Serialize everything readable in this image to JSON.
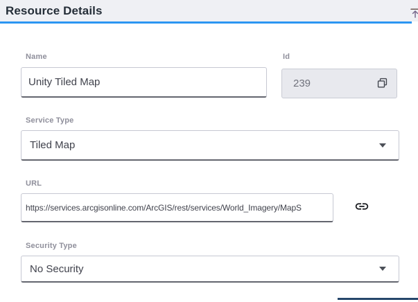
{
  "header": {
    "title": "Resource Details",
    "accent_color": "#2b96f2",
    "collapse_icon": "scroll-to-top-icon"
  },
  "form": {
    "name": {
      "label": "Name",
      "value": "Unity Tiled Map"
    },
    "id": {
      "label": "Id",
      "value": "239",
      "copy_icon": "copy-icon"
    },
    "service_type": {
      "label": "Service Type",
      "value": "Tiled Map",
      "caret_icon": "caret-down-icon"
    },
    "url": {
      "label": "URL",
      "value": "https://services.arcgisonline.com/ArcGIS/rest/services/World_Imagery/MapS",
      "link_icon": "link-icon"
    },
    "security_type": {
      "label": "Security Type",
      "value": "No Security",
      "caret_icon": "caret-down-icon"
    }
  },
  "footer": {
    "accent_color": "#25466b"
  }
}
